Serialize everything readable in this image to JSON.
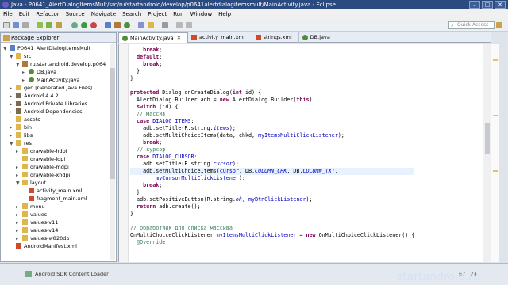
{
  "window": {
    "title": "Java - P0641_AlertDialogItemsMult/src/ru/startandroid/develop/p0641alertdialogitemsmult/MainActivity.java - Eclipse"
  },
  "menu": [
    "File",
    "Edit",
    "Refactor",
    "Source",
    "Navigate",
    "Search",
    "Project",
    "Run",
    "Window",
    "Help"
  ],
  "quick_access": {
    "placeholder": "Quick Access"
  },
  "package_explorer": {
    "title": "Package Explorer",
    "items": [
      {
        "label": "P0641_AlertDialogItemsMult",
        "icon": "project-icon",
        "depth": 0,
        "toggle": "▼"
      },
      {
        "label": "src",
        "icon": "folder-icon",
        "depth": 1,
        "toggle": "▼"
      },
      {
        "label": "ru.startandroid.develop.p064",
        "icon": "package-icon",
        "depth": 2,
        "toggle": "▼"
      },
      {
        "label": "DB.java",
        "icon": "java-file-icon",
        "depth": 3,
        "toggle": "▸"
      },
      {
        "label": "MainActivity.java",
        "icon": "java-file-icon",
        "depth": 3,
        "toggle": "▸"
      },
      {
        "label": "gen [Generated Java Files]",
        "icon": "folder-icon",
        "depth": 1,
        "toggle": "▸"
      },
      {
        "label": "Android 4.4.2",
        "icon": "library-icon",
        "depth": 1,
        "toggle": "▸"
      },
      {
        "label": "Android Private Libraries",
        "icon": "library-icon",
        "depth": 1,
        "toggle": "▸"
      },
      {
        "label": "Android Dependencies",
        "icon": "library-icon",
        "depth": 1,
        "toggle": "▸"
      },
      {
        "label": "assets",
        "icon": "folder-icon",
        "depth": 1,
        "toggle": ""
      },
      {
        "label": "bin",
        "icon": "folder-icon",
        "depth": 1,
        "toggle": "▸"
      },
      {
        "label": "libs",
        "icon": "folder-icon",
        "depth": 1,
        "toggle": "▸"
      },
      {
        "label": "res",
        "icon": "folder-icon",
        "depth": 1,
        "toggle": "▼"
      },
      {
        "label": "drawable-hdpi",
        "icon": "folder-icon",
        "depth": 2,
        "toggle": "▸"
      },
      {
        "label": "drawable-ldpi",
        "icon": "folder-icon",
        "depth": 2,
        "toggle": ""
      },
      {
        "label": "drawable-mdpi",
        "icon": "folder-icon",
        "depth": 2,
        "toggle": "▸"
      },
      {
        "label": "drawable-xhdpi",
        "icon": "folder-icon",
        "depth": 2,
        "toggle": "▸"
      },
      {
        "label": "layout",
        "icon": "folder-icon",
        "depth": 2,
        "toggle": "▼"
      },
      {
        "label": "activity_main.xml",
        "icon": "xml-file-icon",
        "depth": 3,
        "toggle": ""
      },
      {
        "label": "fragment_main.xml",
        "icon": "xml-file-icon",
        "depth": 3,
        "toggle": ""
      },
      {
        "label": "menu",
        "icon": "folder-icon",
        "depth": 2,
        "toggle": "▸"
      },
      {
        "label": "values",
        "icon": "folder-icon",
        "depth": 2,
        "toggle": "▸"
      },
      {
        "label": "values-v11",
        "icon": "folder-icon",
        "depth": 2,
        "toggle": "▸"
      },
      {
        "label": "values-v14",
        "icon": "folder-icon",
        "depth": 2,
        "toggle": "▸"
      },
      {
        "label": "values-w820dp",
        "icon": "folder-icon",
        "depth": 2,
        "toggle": "▸"
      },
      {
        "label": "AndroidManifest.xml",
        "icon": "xml-file-icon",
        "depth": 1,
        "toggle": ""
      }
    ]
  },
  "editor_tabs": [
    {
      "label": "MainActivity.java",
      "icon": "java-file-icon",
      "active": true
    },
    {
      "label": "activity_main.xml",
      "icon": "xml-file-icon",
      "active": false
    },
    {
      "label": "strings.xml",
      "icon": "xml-file-icon",
      "active": false
    },
    {
      "label": "DB.java",
      "icon": "java-file-icon",
      "active": false
    }
  ],
  "code_lines": [
    [
      [
        "    ",
        ""
      ],
      [
        "break",
        "kw"
      ],
      [
        ";",
        ""
      ]
    ],
    [
      [
        "  ",
        ""
      ],
      [
        "default",
        "kw"
      ],
      [
        ":",
        ""
      ]
    ],
    [
      [
        "    ",
        ""
      ],
      [
        "break",
        "kw"
      ],
      [
        ";",
        ""
      ]
    ],
    [
      [
        "  }",
        ""
      ]
    ],
    [
      [
        "}",
        ""
      ]
    ],
    [
      [
        "",
        ""
      ]
    ],
    [
      [
        "",
        ""
      ],
      [
        "protected",
        "kw"
      ],
      [
        " Dialog onCreateDialog(",
        ""
      ],
      [
        "int",
        "kw"
      ],
      [
        " id) {",
        ""
      ]
    ],
    [
      [
        "  AlertDialog.Builder adb = ",
        ""
      ],
      [
        "new",
        "kw"
      ],
      [
        " AlertDialog.Builder(",
        ""
      ],
      [
        "this",
        "kw"
      ],
      [
        ");",
        ""
      ]
    ],
    [
      [
        "  ",
        ""
      ],
      [
        "switch",
        "kw"
      ],
      [
        " (id) {",
        ""
      ]
    ],
    [
      [
        "  ",
        ""
      ],
      [
        "// массив",
        "cm"
      ]
    ],
    [
      [
        "  ",
        ""
      ],
      [
        "case",
        "kw"
      ],
      [
        " ",
        ""
      ],
      [
        "DIALOG_ITEMS",
        "fld2"
      ],
      [
        ":",
        ""
      ]
    ],
    [
      [
        "    adb.setTitle(R.string.",
        ""
      ],
      [
        "items",
        "fld"
      ],
      [
        ");",
        ""
      ]
    ],
    [
      [
        "    adb.setMultiChoiceItems(data, chkd, ",
        ""
      ],
      [
        "myItemsMultiClickListener",
        "fld2"
      ],
      [
        ");",
        ""
      ]
    ],
    [
      [
        "    ",
        ""
      ],
      [
        "break",
        "kw"
      ],
      [
        ";",
        ""
      ]
    ],
    [
      [
        "  ",
        ""
      ],
      [
        "// курсор",
        "cm"
      ]
    ],
    [
      [
        "  ",
        ""
      ],
      [
        "case",
        "kw"
      ],
      [
        " ",
        ""
      ],
      [
        "DIALOG_CURSOR",
        "fld2"
      ],
      [
        ":",
        ""
      ]
    ],
    [
      [
        "    adb.setTitle(R.string.",
        ""
      ],
      [
        "cursor",
        "fld"
      ],
      [
        ");",
        ""
      ]
    ],
    [
      [
        "    adb.setMultiChoiceItems(",
        ""
      ],
      [
        "cursor",
        "fld2"
      ],
      [
        ", DB.",
        ""
      ],
      [
        "COLUMN_CHK",
        "fld"
      ],
      [
        ", DB.",
        ""
      ],
      [
        "COLUMN_TXT",
        "fld"
      ],
      [
        ",",
        ""
      ]
    ],
    [
      [
        "        ",
        ""
      ],
      [
        "myCursorMultiClickListener",
        "fld2"
      ],
      [
        ");",
        ""
      ]
    ],
    [
      [
        "    ",
        ""
      ],
      [
        "break",
        "kw"
      ],
      [
        ";",
        ""
      ]
    ],
    [
      [
        "  }",
        ""
      ]
    ],
    [
      [
        "  adb.setPositiveButton(R.string.",
        ""
      ],
      [
        "ok",
        "fld"
      ],
      [
        ", ",
        ""
      ],
      [
        "myBtnClickListener",
        "fld2"
      ],
      [
        ");",
        ""
      ]
    ],
    [
      [
        "  ",
        ""
      ],
      [
        "return",
        "kw"
      ],
      [
        " adb.create();",
        ""
      ]
    ],
    [
      [
        "}",
        ""
      ]
    ],
    [
      [
        "",
        ""
      ]
    ],
    [
      [
        "",
        ""
      ],
      [
        "// обработчик для списка массива",
        "cm"
      ]
    ],
    [
      [
        "OnMultiChoiceClickListener ",
        ""
      ],
      [
        "myItemsMultiClickListener",
        "fld2"
      ],
      [
        " = ",
        ""
      ],
      [
        "new",
        "kw"
      ],
      [
        " OnMultiChoiceClickListener() {",
        ""
      ]
    ],
    [
      [
        "  ",
        ""
      ],
      [
        "@Override",
        "cm"
      ]
    ]
  ],
  "status": {
    "left": "Android SDK Content Loader",
    "right": "67 : 74"
  },
  "watermark": "startandroid.ru"
}
